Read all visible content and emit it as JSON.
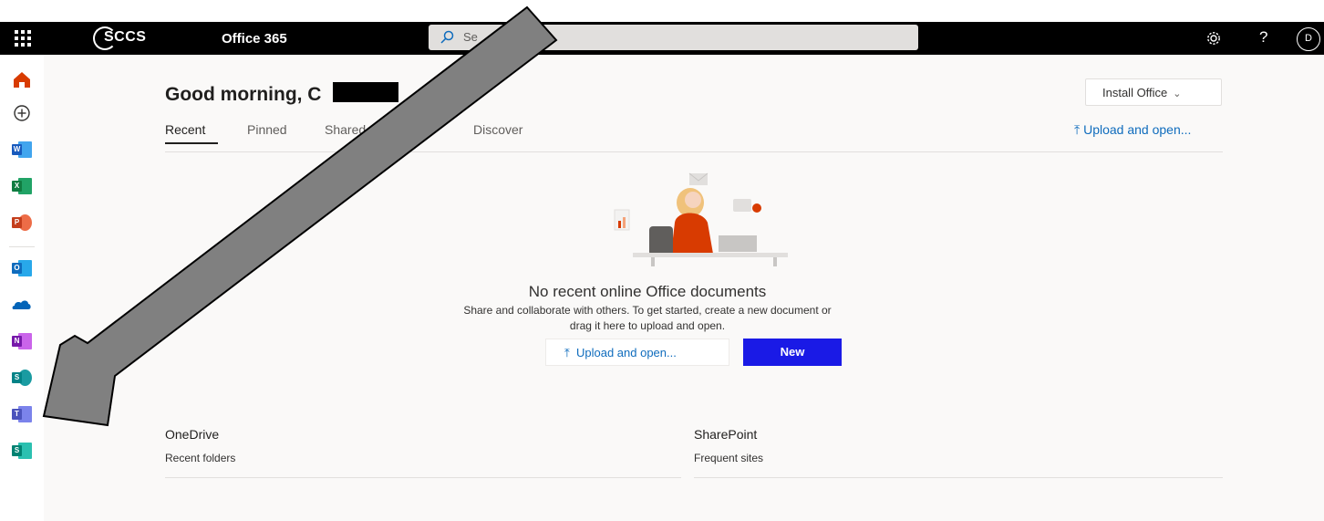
{
  "topbar": {
    "logo_text": "SCCS",
    "app_name": "Office 365",
    "search_placeholder": "Se",
    "icons": [
      "waffle-icon",
      "search-icon",
      "gear-icon",
      "help-icon",
      "avatar"
    ],
    "help_glyph": "?",
    "avatar_initial": "D",
    "colors": {
      "bar": "#000000",
      "search": "#e1dfdd"
    }
  },
  "rail": {
    "items": [
      "home-icon",
      "create-icon",
      "word-icon",
      "excel-icon",
      "powerpoint-icon",
      "outlook-icon",
      "onedrive-icon",
      "onenote-icon",
      "sharepoint-icon",
      "teams-icon",
      "sway-icon"
    ],
    "labels": {
      "word": "W",
      "excel": "X",
      "powerpoint": "P",
      "outlook": "O",
      "onenote": "N",
      "sharepoint": "S",
      "teams": "T",
      "sway": "S"
    },
    "colors": {
      "home": "#d83b01",
      "word": "#185abd",
      "excel": "#107c41",
      "powerpoint": "#c43e1c",
      "outlook": "#0f6cbd",
      "onedrive": "#0364b8",
      "onenote": "#7719aa",
      "sharepoint": "#038387",
      "teams": "#4b53bc",
      "sway": "#008272"
    }
  },
  "main": {
    "greeting": "Good morning, C",
    "install_button": "Install Office",
    "tabs": [
      {
        "label": "Recent",
        "active": true
      },
      {
        "label": "Pinned",
        "active": false
      },
      {
        "label": "Shared",
        "active": false
      },
      {
        "label": "Discover",
        "active": false
      }
    ],
    "upload_link": "Upload and open...",
    "empty": {
      "title": "No recent online Office documents",
      "line1": "Share and collaborate with others. To get started, create a new document or",
      "line2": "drag it here to upload and open."
    },
    "buttons": {
      "upload": "Upload and open...",
      "new": "New"
    },
    "sections": [
      {
        "title": "OneDrive",
        "subtitle": "Recent folders"
      },
      {
        "title": "SharePoint",
        "subtitle": "Frequent sites"
      }
    ],
    "accent": "#1a1ae6"
  },
  "annotation": {
    "type": "arrow",
    "fill": "#808080",
    "stroke": "#000000",
    "points_to": "teams-icon"
  }
}
